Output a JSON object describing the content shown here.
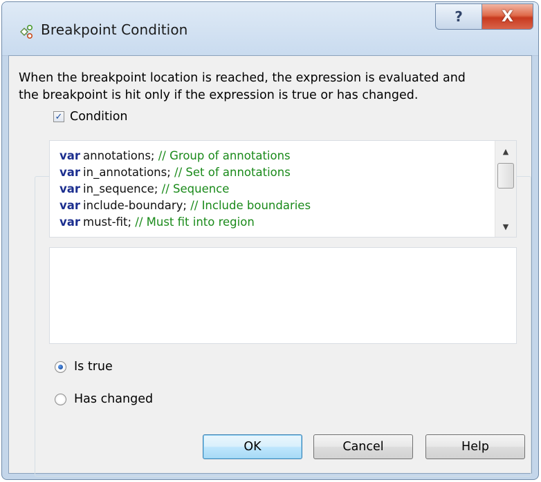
{
  "window": {
    "title": "Breakpoint Condition",
    "help_label": "?",
    "close_label": "X"
  },
  "description": "When the breakpoint location is reached, the expression is evaluated and\nthe breakpoint is hit only if the expression is true or has changed.",
  "condition": {
    "label": "Condition",
    "checked": true,
    "checkmark": "✓"
  },
  "code": {
    "lines": [
      {
        "keyword": "var",
        "name": "annotations;",
        "comment": "// Group of annotations"
      },
      {
        "keyword": "var",
        "name": "in_annotations;",
        "comment": "// Set of annotations"
      },
      {
        "keyword": "var",
        "name": "in_sequence;",
        "comment": "// Sequence"
      },
      {
        "keyword": "var",
        "name": "include-boundary;",
        "comment": "// Include boundaries"
      },
      {
        "keyword": "var",
        "name": "must-fit;",
        "comment": "// Must fit into region"
      }
    ],
    "scroll_up_glyph": "▲",
    "scroll_down_glyph": "▼"
  },
  "expression": {
    "value": ""
  },
  "options": [
    {
      "label": "Is true",
      "selected": true
    },
    {
      "label": "Has changed",
      "selected": false
    }
  ],
  "buttons": {
    "ok": "OK",
    "cancel": "Cancel",
    "help": "Help"
  },
  "colors": {
    "keyword": "#1c2f8f",
    "comment": "#1a8a1a",
    "close_button": "#c83a1f"
  },
  "icons": {
    "app": "breakpoint-condition-icon",
    "help": "question-mark-icon",
    "close": "close-icon"
  }
}
